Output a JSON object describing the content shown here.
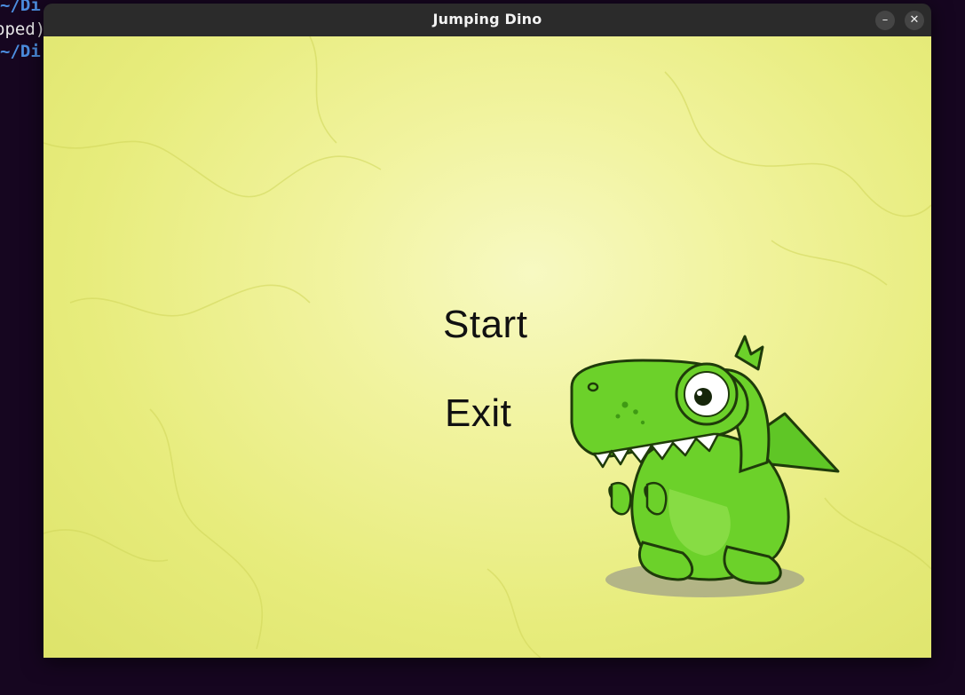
{
  "terminal": {
    "lines": [
      "~/Di",
      "pped)",
      "~/Di"
    ]
  },
  "window": {
    "title": "Jumping Dino",
    "minimize_label": "–",
    "close_label": "✕"
  },
  "menu": {
    "start_label": "Start",
    "exit_label": "Exit"
  },
  "colors": {
    "background_center": "#f7f9c2",
    "background_edge": "#dde36a",
    "dino_green": "#6cd12a",
    "titlebar": "#2b2b2b"
  },
  "icons": {
    "minimize": "minimize-icon",
    "close": "close-icon",
    "mascot": "dinosaur-illustration"
  }
}
